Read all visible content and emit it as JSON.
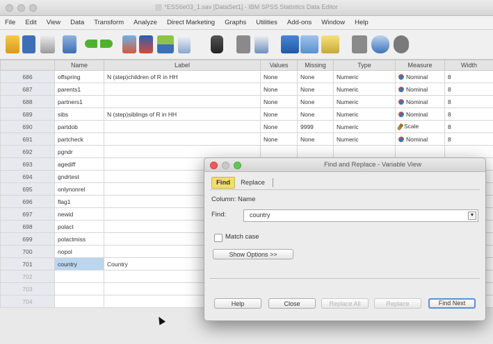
{
  "window": {
    "title": "*ESS6e03_1.sav [DataSet1] - IBM SPSS Statistics Data Editor"
  },
  "menu": [
    "File",
    "Edit",
    "View",
    "Data",
    "Transform",
    "Analyze",
    "Direct Marketing",
    "Graphs",
    "Utilities",
    "Add-ons",
    "Window",
    "Help"
  ],
  "columns": [
    "Name",
    "Label",
    "Values",
    "Missing",
    "Type",
    "Measure",
    "Width"
  ],
  "rows": [
    {
      "n": "686",
      "name": "offspring",
      "label": "N (step)children of R in HH",
      "values": "None",
      "missing": "None",
      "type": "Numeric",
      "measure": "Nominal",
      "width": "8"
    },
    {
      "n": "687",
      "name": "parents1",
      "label": "",
      "values": "None",
      "missing": "None",
      "type": "Numeric",
      "measure": "Nominal",
      "width": "8"
    },
    {
      "n": "688",
      "name": "partners1",
      "label": "",
      "values": "None",
      "missing": "None",
      "type": "Numeric",
      "measure": "Nominal",
      "width": "8"
    },
    {
      "n": "689",
      "name": "sibs",
      "label": "N (step)siblings of R in HH",
      "values": "None",
      "missing": "None",
      "type": "Numeric",
      "measure": "Nominal",
      "width": "8"
    },
    {
      "n": "690",
      "name": "partdob",
      "label": "",
      "values": "None",
      "missing": "9999",
      "type": "Numeric",
      "measure": "Scale",
      "width": "8"
    },
    {
      "n": "691",
      "name": "partcheck",
      "label": "",
      "values": "None",
      "missing": "None",
      "type": "Numeric",
      "measure": "Nominal",
      "width": "8"
    },
    {
      "n": "692",
      "name": "pgndr",
      "label": "",
      "values": "",
      "missing": "",
      "type": "",
      "measure": "",
      "width": ""
    },
    {
      "n": "693",
      "name": "agediff",
      "label": "",
      "values": "",
      "missing": "",
      "type": "",
      "measure": "",
      "width": ""
    },
    {
      "n": "694",
      "name": "gndrtest",
      "label": "",
      "values": "",
      "missing": "",
      "type": "",
      "measure": "",
      "width": ""
    },
    {
      "n": "695",
      "name": "onlynonrel",
      "label": "",
      "values": "",
      "missing": "",
      "type": "",
      "measure": "",
      "width": ""
    },
    {
      "n": "696",
      "name": "flag1",
      "label": "",
      "values": "",
      "missing": "",
      "type": "",
      "measure": "",
      "width": ""
    },
    {
      "n": "697",
      "name": "newid",
      "label": "",
      "values": "",
      "missing": "",
      "type": "",
      "measure": "",
      "width": ""
    },
    {
      "n": "698",
      "name": "polact",
      "label": "",
      "values": "",
      "missing": "",
      "type": "",
      "measure": "",
      "width": ""
    },
    {
      "n": "699",
      "name": "polactmiss",
      "label": "",
      "values": "",
      "missing": "",
      "type": "",
      "measure": "",
      "width": ""
    },
    {
      "n": "700",
      "name": "nopol",
      "label": "",
      "values": "",
      "missing": "",
      "type": "",
      "measure": "",
      "width": ""
    },
    {
      "n": "701",
      "name": "country",
      "label": "Country",
      "values": "",
      "missing": "",
      "type": "",
      "measure": "",
      "width": ""
    },
    {
      "n": "702",
      "name": "",
      "label": "",
      "values": "",
      "missing": "",
      "type": "",
      "measure": "",
      "width": ""
    },
    {
      "n": "703",
      "name": "",
      "label": "",
      "values": "",
      "missing": "",
      "type": "",
      "measure": "",
      "width": ""
    },
    {
      "n": "704",
      "name": "",
      "label": "",
      "values": "",
      "missing": "",
      "type": "",
      "measure": "",
      "width": ""
    }
  ],
  "dialog": {
    "title": "Find and Replace - Variable View",
    "tabs": [
      "Find",
      "Replace"
    ],
    "column_label": "Column:",
    "column_value": "Name",
    "find_label": "Find:",
    "find_value": "country",
    "match_case": "Match case",
    "show_options": "Show Options >>",
    "buttons": {
      "help": "Help",
      "close": "Close",
      "replace_all": "Replace All",
      "replace": "Replace",
      "find_next": "Find Next"
    }
  },
  "colors": {
    "selected_cell": "#bcd6f0",
    "active_tab": "#f2de6a",
    "close_light": "#ef5a57",
    "max_light": "#62c654"
  }
}
